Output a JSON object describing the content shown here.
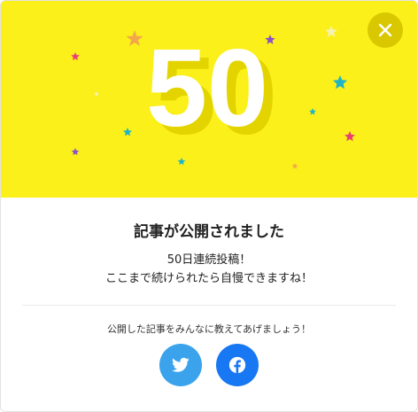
{
  "hero": {
    "number": "50",
    "background_color": "#fbf01a"
  },
  "close_button": {
    "icon": "close-icon"
  },
  "dialog": {
    "title": "記事が公開されました",
    "message_line1": "50日連続投稿！",
    "message_line2": "ここまで続けられたら自慢できますね！",
    "share_prompt": "公開した記事をみんなに教えてあげましょう！"
  },
  "share": {
    "twitter": {
      "icon": "twitter-bird-icon",
      "color": "#3aa3ec"
    },
    "facebook": {
      "icon": "facebook-icon",
      "color": "#1877f2"
    }
  }
}
